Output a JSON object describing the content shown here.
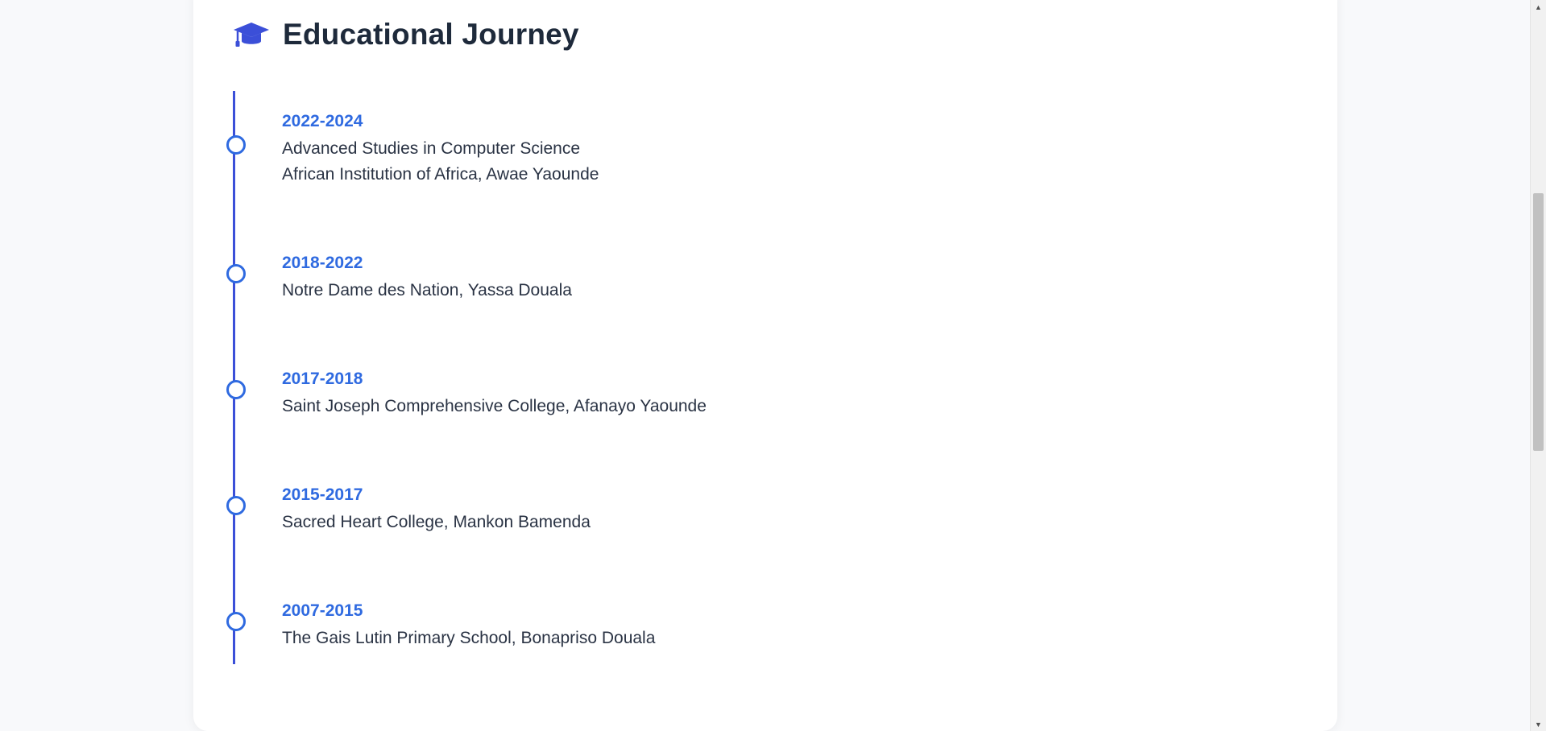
{
  "section": {
    "title": "Educational Journey",
    "icon": "graduation-cap-icon",
    "accent_color": "#2f6ae0",
    "line_color": "#3b4fd8"
  },
  "timeline": [
    {
      "period": "2022-2024",
      "lines": [
        "Advanced Studies in Computer Science",
        "African Institution of Africa, Awae Yaounde"
      ]
    },
    {
      "period": "2018-2022",
      "lines": [
        "Notre Dame des Nation, Yassa Douala"
      ]
    },
    {
      "period": "2017-2018",
      "lines": [
        "Saint Joseph Comprehensive College, Afanayo Yaounde"
      ]
    },
    {
      "period": "2015-2017",
      "lines": [
        "Sacred Heart College, Mankon Bamenda"
      ]
    },
    {
      "period": "2007-2015",
      "lines": [
        "The Gais Lutin Primary School, Bonapriso Douala"
      ]
    }
  ]
}
